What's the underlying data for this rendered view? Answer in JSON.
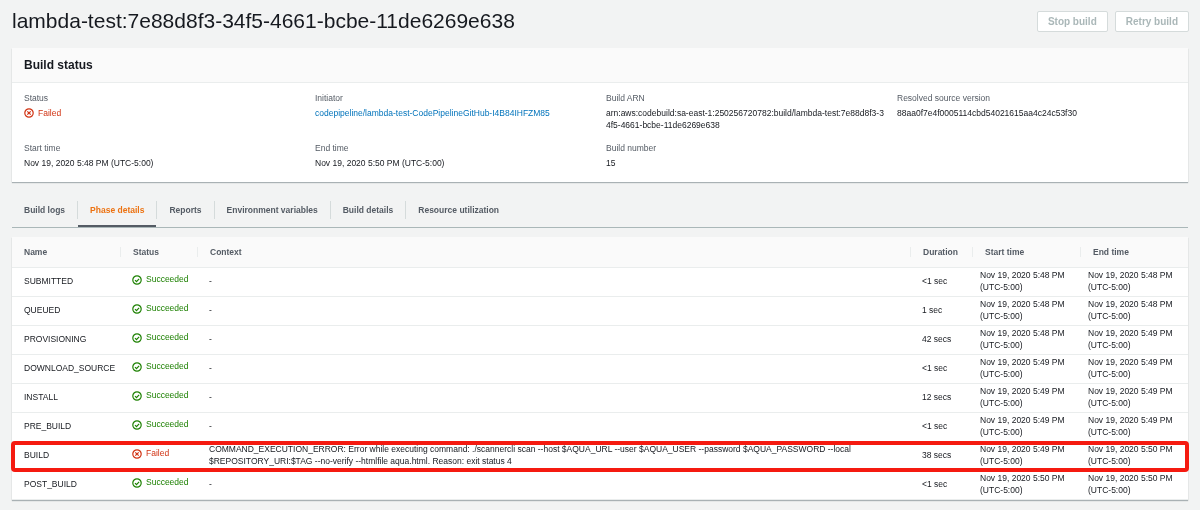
{
  "title": "lambda-test:7e88d8f3-34f5-4661-bcbe-11de6269e638",
  "actions": [
    {
      "label": "Stop build",
      "disabled": true
    },
    {
      "label": "Retry build",
      "disabled": true
    }
  ],
  "build_status": {
    "heading": "Build status",
    "fields": [
      {
        "label": "Status",
        "kind": "failed",
        "value": "Failed"
      },
      {
        "label": "Initiator",
        "kind": "link",
        "value": "codepipeline/lambda-test-CodePipelineGitHub-I4B84IHFZM85"
      },
      {
        "label": "Build ARN",
        "kind": "text",
        "value": "arn:aws:codebuild:sa-east-1:250256720782:build/lambda-test:7e88d8f3-34f5-4661-bcbe-11de6269e638"
      },
      {
        "label": "Resolved source version",
        "kind": "text",
        "value": "88aa0f7e4f0005114cbd54021615aa4c24c53f30"
      },
      {
        "label": "Start time",
        "kind": "text",
        "value": "Nov 19, 2020 5:48 PM (UTC-5:00)"
      },
      {
        "label": "End time",
        "kind": "text",
        "value": "Nov 19, 2020 5:50 PM (UTC-5:00)"
      },
      {
        "label": "Build number",
        "kind": "text",
        "value": "15"
      }
    ]
  },
  "tabs": [
    {
      "label": "Build logs",
      "selected": false
    },
    {
      "label": "Phase details",
      "selected": true
    },
    {
      "label": "Reports",
      "selected": false
    },
    {
      "label": "Environment variables",
      "selected": false
    },
    {
      "label": "Build details",
      "selected": false
    },
    {
      "label": "Resource utilization",
      "selected": false
    }
  ],
  "table": {
    "columns": [
      "Name",
      "Status",
      "Context",
      "Duration",
      "Start time",
      "End time"
    ],
    "rows": [
      {
        "name": "SUBMITTED",
        "kind": "succeeded",
        "status_label": "Succeeded",
        "context": "-",
        "duration": "<1 sec",
        "start": "Nov 19, 2020 5:48 PM (UTC-5:00)",
        "end": "Nov 19, 2020 5:48 PM (UTC-5:00)",
        "highlighted": false
      },
      {
        "name": "QUEUED",
        "kind": "succeeded",
        "status_label": "Succeeded",
        "context": "-",
        "duration": "1 sec",
        "start": "Nov 19, 2020 5:48 PM (UTC-5:00)",
        "end": "Nov 19, 2020 5:48 PM (UTC-5:00)",
        "highlighted": false
      },
      {
        "name": "PROVISIONING",
        "kind": "succeeded",
        "status_label": "Succeeded",
        "context": "-",
        "duration": "42 secs",
        "start": "Nov 19, 2020 5:48 PM (UTC-5:00)",
        "end": "Nov 19, 2020 5:49 PM (UTC-5:00)",
        "highlighted": false
      },
      {
        "name": "DOWNLOAD_SOURCE",
        "kind": "succeeded",
        "status_label": "Succeeded",
        "context": "-",
        "duration": "<1 sec",
        "start": "Nov 19, 2020 5:49 PM (UTC-5:00)",
        "end": "Nov 19, 2020 5:49 PM (UTC-5:00)",
        "highlighted": false
      },
      {
        "name": "INSTALL",
        "kind": "succeeded",
        "status_label": "Succeeded",
        "context": "-",
        "duration": "12 secs",
        "start": "Nov 19, 2020 5:49 PM (UTC-5:00)",
        "end": "Nov 19, 2020 5:49 PM (UTC-5:00)",
        "highlighted": false
      },
      {
        "name": "PRE_BUILD",
        "kind": "succeeded",
        "status_label": "Succeeded",
        "context": "-",
        "duration": "<1 sec",
        "start": "Nov 19, 2020 5:49 PM (UTC-5:00)",
        "end": "Nov 19, 2020 5:49 PM (UTC-5:00)",
        "highlighted": false
      },
      {
        "name": "BUILD",
        "kind": "failed",
        "status_label": "Failed",
        "context": "COMMAND_EXECUTION_ERROR: Error while executing command: ./scannercli scan --host $AQUA_URL --user $AQUA_USER --password $AQUA_PASSWORD --local $REPOSITORY_URI:$TAG --no-verify --htmlfile aqua.html. Reason: exit status 4",
        "duration": "38 secs",
        "start": "Nov 19, 2020 5:49 PM (UTC-5:00)",
        "end": "Nov 19, 2020 5:50 PM (UTC-5:00)",
        "highlighted": true
      },
      {
        "name": "POST_BUILD",
        "kind": "succeeded",
        "status_label": "Succeeded",
        "context": "-",
        "duration": "<1 sec",
        "start": "Nov 19, 2020 5:50 PM (UTC-5:00)",
        "end": "Nov 19, 2020 5:50 PM (UTC-5:00)",
        "highlighted": false
      }
    ]
  }
}
